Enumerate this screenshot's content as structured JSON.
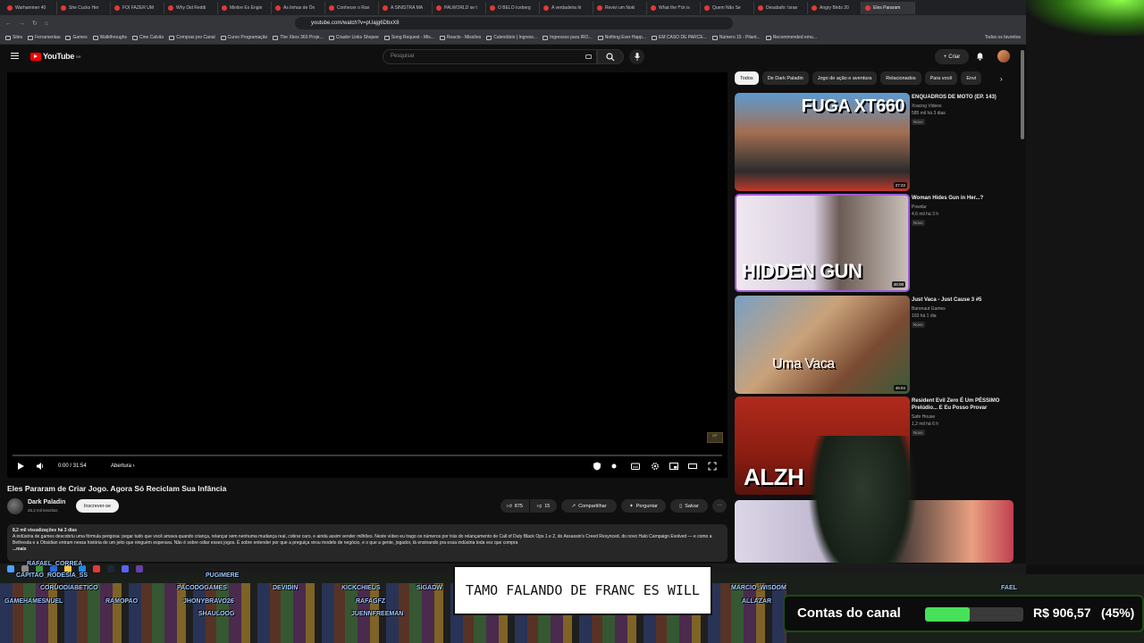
{
  "browser": {
    "tabs": [
      {
        "label": "Warhammer 40"
      },
      {
        "label": "She Cucks Her"
      },
      {
        "label": "FOI FAZER UM"
      },
      {
        "label": "Why Did Reddi"
      },
      {
        "label": "Minitre Ex Engin"
      },
      {
        "label": "As linhas de Ón"
      },
      {
        "label": "Conhecer o Ran"
      },
      {
        "label": "A SINISTRA MA"
      },
      {
        "label": "PALWORLD se t"
      },
      {
        "label": "O BELO Iceberg"
      },
      {
        "label": "A verdadeira hi"
      },
      {
        "label": "Revivi um Noki"
      },
      {
        "label": "What the f*ck is"
      },
      {
        "label": "Quem Não Se"
      },
      {
        "label": "Desabafo: Israe"
      },
      {
        "label": "Angry Birds 20"
      },
      {
        "label": "Eles Pararam"
      }
    ],
    "url": "youtube.com/watch?v=pUajg6DbxX8",
    "bookmarks": [
      "Sites",
      "Ferramentas",
      "Games",
      "Walkthroughs",
      "Cine Calvão",
      "Compras pro Canal",
      "Curso Programação",
      "The Xbox 360 Proje...",
      "Criador Links Shopee",
      "Song Request - Mis...",
      "Reacts - Missões",
      "Calendário | Ingress...",
      "Ingressos para IRO...",
      "Nothing Ever Happ...",
      "EM CASO DE PARCE...",
      "Número 15 - Pilant...",
      "Recommended emu..."
    ],
    "all_favorites": "Todos os favoritos"
  },
  "youtube": {
    "logo": "YouTube",
    "logo_country": "BR",
    "search_placeholder": "Pesquisar",
    "create_label": "Criar",
    "player": {
      "time": "0:00 / 31:54",
      "chapter": "Abertura ›"
    },
    "video": {
      "title": "Eles Pararam de Criar Jogo. Agora Só Reciclam Sua Infância",
      "channel": "Dark Paladin",
      "subscribers": "25,2 mil inscritos",
      "subscribe_label": "Inscrever-se",
      "likes": "875",
      "dislikes": "15",
      "share_label": "Compartilhar",
      "ask_label": "Perguntar",
      "save_label": "Salvar",
      "views": "8,2 mil visualizações  há 3 dias",
      "description": "A indústria de games descobriu uma fórmula perigosa: pegar tudo que você amava quando criança, relançar sem nenhuma mudança real, cobrar caro, e ainda assim vender milhões. Neste vídeo eu trago os números por trás do relançamento de Call of Duty Black Ops 1 e 2, do Assassin's Creed Resynced, do novo Halo Campaign Evolved — e como a Bethesda e a Obsidian entram nessa história de um jeito que ninguém esperava. Não é sobre odiar esses jogos. É sobre entender por que a preguiça virou modelo de negócio, e o que a gente, jogador, tá ensinando pra essa indústria toda vez que compra",
      "more": "...mais"
    },
    "chips": [
      "Todos",
      "De Dark Paladin",
      "Jogo de ação e aventura",
      "Relacionados",
      "Para você",
      "Envi"
    ],
    "recommendations": [
      {
        "title": "ENQUADROS DE MOTO (EP. 143)",
        "channel": "Xracing Videos",
        "meta": "585 mil  há 3 dias",
        "badge": "Novo",
        "duration": "27:22",
        "overlay": "FUGA XT660"
      },
      {
        "title": "Woman Hides Gun in Her...?",
        "channel": "Powdur",
        "meta": "4,6 mil  há 3 h",
        "badge": "Novo",
        "duration": "46:08",
        "overlay": "HIDDEN GUN"
      },
      {
        "title": "Just Vaca - Just Cause 3 #5",
        "channel": "Baronaut Games",
        "meta": "103  há 1 dia",
        "badge": "Novo",
        "duration": "45:04",
        "overlay": "Uma Vaca"
      },
      {
        "title": "Resident Evil Zero É Um PÉSSIMO Prelúdio... E Eu Posso Provar",
        "channel": "Safe House",
        "meta": "1,2 mil  há 6 h",
        "badge": "Novo",
        "duration": "",
        "overlay": "ALZH"
      }
    ]
  },
  "stream_overlay": {
    "usernames": [
      "RAFAEL_CORREA",
      "CAPITAO_RODESIA_SS",
      "CORUODIABETICO",
      "PUGIMERE",
      "PACODOGAMES",
      "DEVIDIN",
      "KICKCHIEUS",
      "SIGADW",
      "GAMEHAMESNUEL",
      "RAMOPAO",
      "JHONYBRAVO26",
      "SHAULOOG",
      "RAFAGFZ",
      "JUENNFREEMAN",
      "MARCIO_WISDOM",
      "ALLAZAR",
      "FAEL"
    ],
    "caption": "TAMO FALANDO DE FRANC ES WILL",
    "accounts_label": "Contas do canal",
    "accounts_amount": "R$ 906,57",
    "accounts_percent_label": "(45%)",
    "accounts_percent": 45
  },
  "colors": {
    "yt_background": "#0f0f0f",
    "yt_red": "#ff0000",
    "progress_green": "#46e05a",
    "overlay_green": "#8cff4a"
  }
}
